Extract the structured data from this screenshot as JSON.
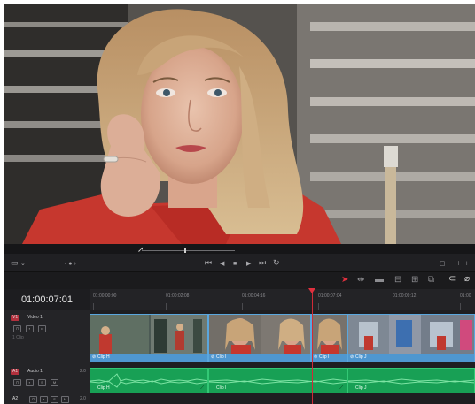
{
  "viewer": {
    "name": "clip-viewer"
  },
  "transport": {
    "view_icon": "monitor-icon",
    "nav_dots": "‹ ● ›",
    "buttons": [
      "skip-to-start-icon",
      "step-back-icon",
      "stop-icon",
      "play-icon",
      "skip-to-end-icon",
      "loop-icon"
    ],
    "glyphs": {
      "skip_start": "⏮",
      "back": "◀",
      "stop": "■",
      "play": "▶",
      "skip_end": "⏭",
      "loop": "↻"
    }
  },
  "toolbar": {
    "tools": [
      "pointer-icon",
      "trim-icon",
      "blade-icon",
      "overwrite-icon",
      "insert-icon",
      "replace-icon",
      "snap-icon",
      "link-icon"
    ]
  },
  "timeline": {
    "timecode": "01:00:07:01",
    "ruler_ticks": [
      "01:00:00:00",
      "01:00:02:08",
      "01:00:04:16",
      "01:00:07:04",
      "01:00:09:12",
      "01:00"
    ],
    "tracks": {
      "video": {
        "badge": "V1",
        "name": "Video 1",
        "sub": "1 Clip"
      },
      "audio": {
        "badge": "A1",
        "name": "Audio 1",
        "level": "2.0"
      },
      "audio2": {
        "badge": "A2",
        "level": "2.0"
      }
    },
    "video_clips": [
      {
        "label": "Clip H"
      },
      {
        "label": "Clip I"
      },
      {
        "label": "Clip I"
      },
      {
        "label": "Clip J"
      }
    ],
    "audio_clips": [
      {
        "label": "Clip H"
      },
      {
        "label": "Clip I"
      },
      {
        "label": "Clip J"
      }
    ]
  },
  "colors": {
    "video_clip": "#4f97d0",
    "audio_clip": "#18a055",
    "playhead": "#d12a37",
    "track_badge": "#b2303d"
  }
}
